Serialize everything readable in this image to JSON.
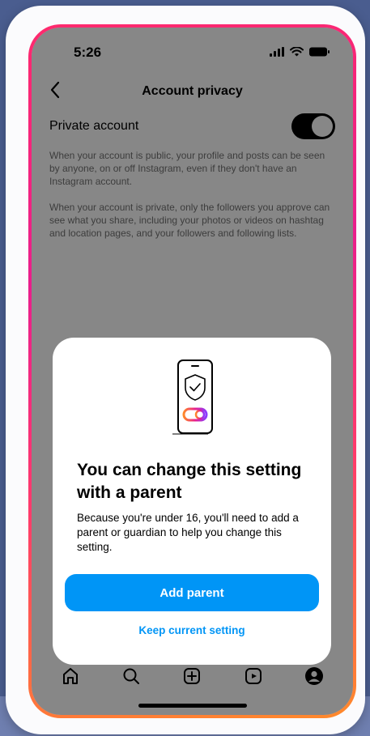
{
  "status_bar": {
    "time": "5:26",
    "icons": [
      "signal-icon",
      "wifi-icon",
      "battery-icon"
    ]
  },
  "header": {
    "back_icon": "chevron-left-icon",
    "title": "Account privacy"
  },
  "settings": {
    "private_label": "Private account",
    "private_enabled": true,
    "public_description": "When your account is public, your profile and posts can be seen by anyone, on or off Instagram, even if they don't have an Instagram account.",
    "private_description": "When your account is private, only the followers you approve can see what you share, including your photos or videos on hashtag and location pages, and your followers and following lists."
  },
  "dialog": {
    "illustration_icon": "phone-shield-icon",
    "title": "You can change this setting with a parent",
    "body": "Because you're under 16, you'll need to add a parent or guardian to help you change this setting.",
    "primary_label": "Add parent",
    "secondary_label": "Keep current setting"
  },
  "tab_bar": {
    "items": [
      "home-icon",
      "search-icon",
      "create-icon",
      "reels-icon",
      "profile-icon"
    ]
  },
  "colors": {
    "accent": "#0095f6",
    "frame_gradient_top": "#ff2a6d",
    "frame_gradient_bottom": "#ff8a2b",
    "background": "#4a5d8f"
  }
}
